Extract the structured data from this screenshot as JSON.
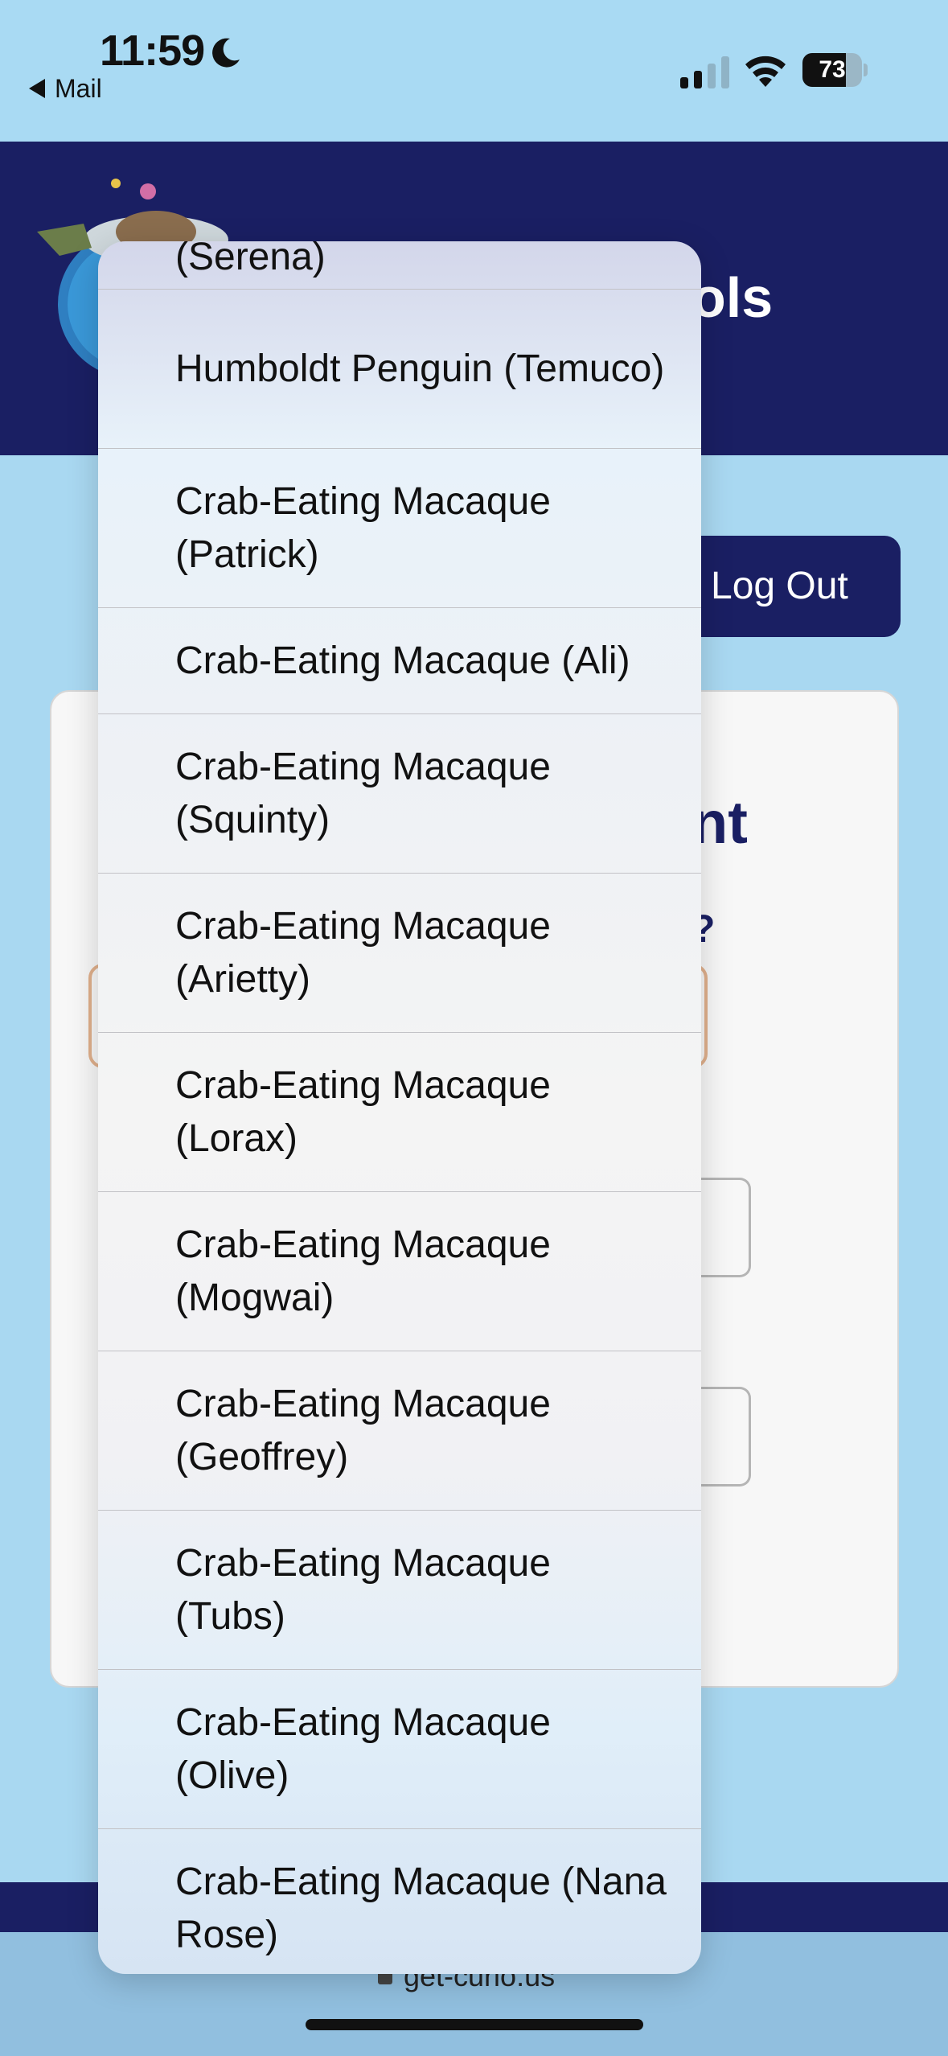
{
  "status_bar": {
    "time": "11:59",
    "back_label": "Mail",
    "battery_level": "73",
    "battery_fraction": 0.73
  },
  "header": {
    "title_fragment": "ols"
  },
  "logout_label": "Log Out",
  "card": {
    "heading_fragment": "nt",
    "question_fragment": "?"
  },
  "url": "get-curio.us",
  "picker": {
    "items": [
      "(Serena)",
      "Humboldt Penguin (Temuco)",
      "Crab-Eating Macaque (Patrick)",
      "Crab-Eating Macaque (Ali)",
      "Crab-Eating Macaque (Squinty)",
      "Crab-Eating Macaque (Arietty)",
      "Crab-Eating Macaque (Lorax)",
      "Crab-Eating Macaque (Mogwai)",
      "Crab-Eating Macaque (Geoffrey)",
      "Crab-Eating Macaque (Tubs)",
      "Crab-Eating Macaque (Olive)",
      "Crab-Eating Macaque (Nana Rose)"
    ]
  },
  "colors": {
    "brand_navy": "#1a1f63",
    "page_bg": "#a9d8f1",
    "select_focus": "#e0b08c"
  }
}
